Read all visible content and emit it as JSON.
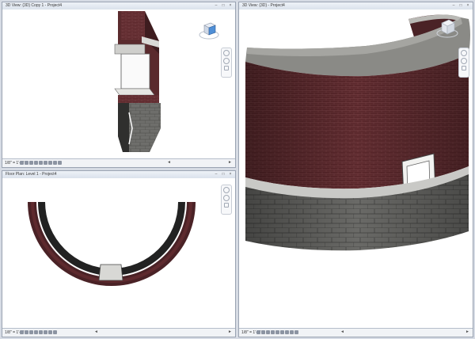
{
  "windows": {
    "top_left": {
      "title": "3D View: {3D} Copy 1 - Project4",
      "scale": "1/8\" = 1'-0\""
    },
    "bottom_left": {
      "title": "Floor Plan: Level 1 - Project4",
      "scale": "1/8\" = 1'-0\""
    },
    "right": {
      "title": "3D View: {3D} - Project4",
      "scale": "1/8\" = 1'-0\""
    }
  },
  "window_buttons": {
    "minimize": "–",
    "maximize": "□",
    "close": "×"
  },
  "scroll": {
    "left": "◄",
    "right": "►"
  },
  "viewcube": {
    "face_label": "FRONT"
  },
  "colors": {
    "brick": "#5e2a2e",
    "stone": "#6b6b68",
    "cap": "#8a8a86",
    "window_chrome": "#dbe2ec",
    "background": "#d6dbe4"
  },
  "icons": [
    "viewcube-icon",
    "steering-wheel-icon",
    "zoom-icon",
    "pan-icon"
  ]
}
